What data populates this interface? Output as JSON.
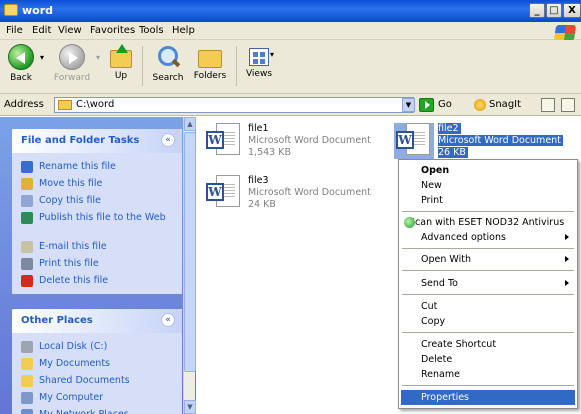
{
  "window": {
    "title": "word",
    "controls": [
      "_",
      "□",
      "X"
    ]
  },
  "menubar": [
    "File",
    "Edit",
    "View",
    "Favorites",
    "Tools",
    "Help"
  ],
  "toolbar": {
    "back": "Back",
    "forward": "Forward",
    "up": "Up",
    "search": "Search",
    "folders": "Folders",
    "views": "Views"
  },
  "address": {
    "label": "Address",
    "value": "C:\\word",
    "go": "Go",
    "snagit": "SnagIt"
  },
  "tasks_panel": {
    "title": "File and Folder Tasks",
    "items": [
      {
        "label": "Rename this file",
        "icon": "rename-icon",
        "color": "#3b6cc9"
      },
      {
        "label": "Move this file",
        "icon": "move-icon",
        "color": "#e0b13c"
      },
      {
        "label": "Copy this file",
        "icon": "copy-icon",
        "color": "#8fa6d6"
      },
      {
        "label": "Publish this file to the Web",
        "icon": "globe-icon",
        "color": "#2e8b57"
      },
      {
        "label": "E-mail this file",
        "icon": "email-icon",
        "color": "#c9c1a6"
      },
      {
        "label": "Print this file",
        "icon": "printer-icon",
        "color": "#7c8aa0"
      },
      {
        "label": "Delete this file",
        "icon": "delete-icon",
        "color": "#d42a1b"
      }
    ]
  },
  "places_panel": {
    "title": "Other Places",
    "items": [
      {
        "label": "Local Disk (C:)",
        "icon": "disk-icon",
        "color": "#9ea4b0"
      },
      {
        "label": "My Documents",
        "icon": "folder-icon",
        "color": "#f3cd52"
      },
      {
        "label": "Shared Documents",
        "icon": "folder-icon",
        "color": "#f3cd52"
      },
      {
        "label": "My Computer",
        "icon": "computer-icon",
        "color": "#7d99c9"
      },
      {
        "label": "My Network Places",
        "icon": "network-icon",
        "color": "#6e8fc9"
      }
    ]
  },
  "files": [
    {
      "name": "file1",
      "type": "Microsoft Word Document",
      "size": "1,543 KB",
      "selected": false
    },
    {
      "name": "file2",
      "type": "Microsoft Word Document",
      "size": "26 KB",
      "selected": true
    },
    {
      "name": "file3",
      "type": "Microsoft Word Document",
      "size": "24 KB",
      "selected": false
    }
  ],
  "context_menu": {
    "open": "Open",
    "new": "New",
    "print": "Print",
    "scan": "Scan with ESET NOD32 Antivirus",
    "advanced": "Advanced options",
    "open_with": "Open With",
    "send_to": "Send To",
    "cut": "Cut",
    "copy": "Copy",
    "create_shortcut": "Create Shortcut",
    "delete": "Delete",
    "rename": "Rename",
    "properties": "Properties"
  }
}
